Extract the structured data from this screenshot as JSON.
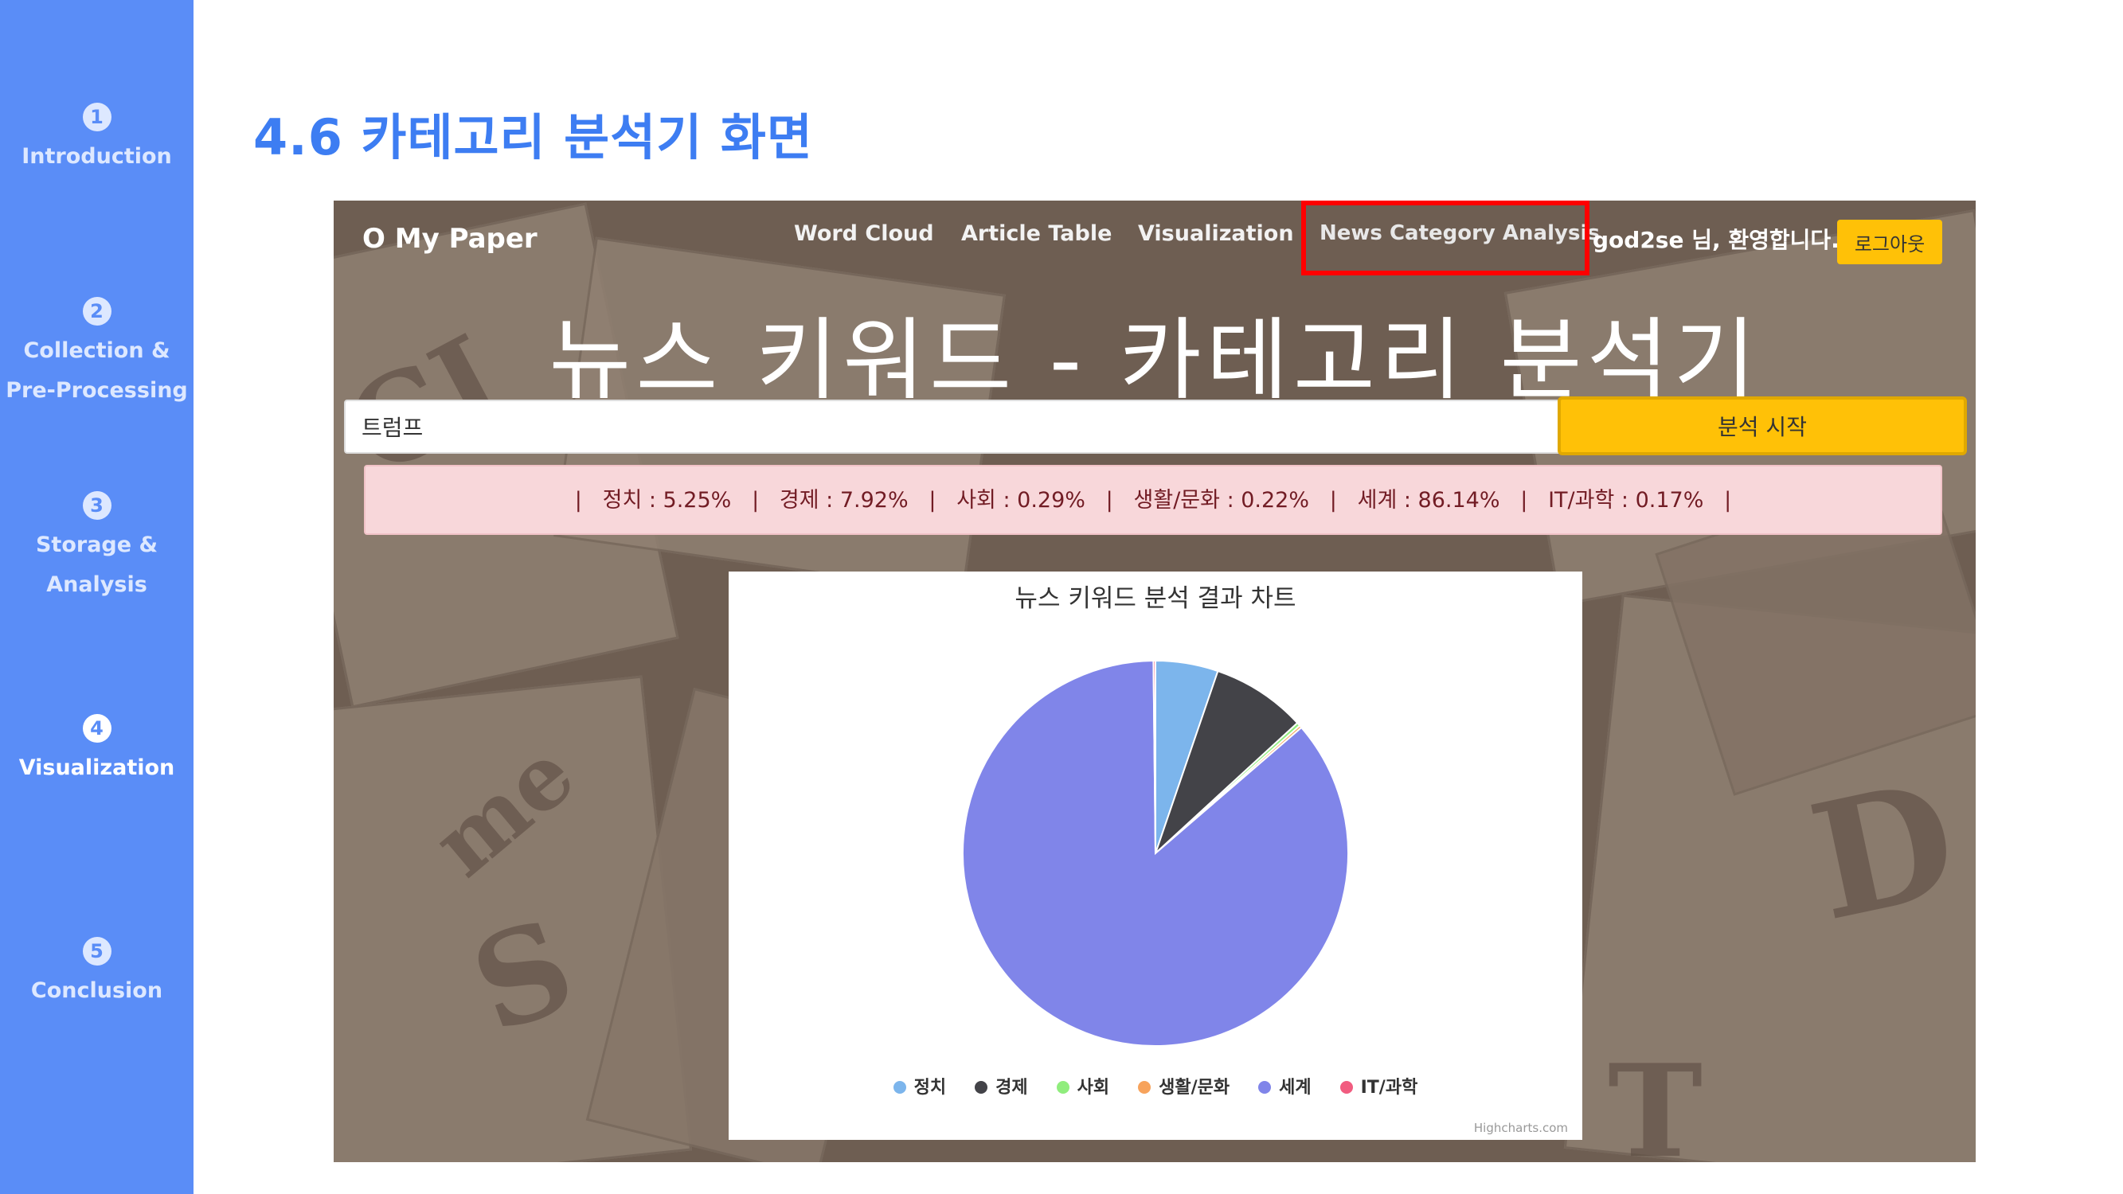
{
  "sidebar": {
    "items": [
      {
        "num": "1",
        "label_lines": [
          "Introduction"
        ],
        "active": false
      },
      {
        "num": "2",
        "label_lines": [
          "Collection &",
          "Pre-Processing"
        ],
        "active": false
      },
      {
        "num": "3",
        "label_lines": [
          "Storage &",
          "Analysis"
        ],
        "active": false
      },
      {
        "num": "4",
        "label_lines": [
          "Visualization"
        ],
        "active": true
      },
      {
        "num": "5",
        "label_lines": [
          "Conclusion"
        ],
        "active": false
      }
    ]
  },
  "slide": {
    "title": "4.6 카테고리 분석기 화면"
  },
  "app": {
    "brand": "O My Paper",
    "nav": [
      "Word Cloud",
      "Article Table",
      "Visualization",
      "News Category Analysis"
    ],
    "welcome": "god2se 님, 환영합니다.",
    "logout_label": "로그아웃",
    "heading": "뉴스 키워드 - 카테고리 분석기",
    "search_value": "트럼프",
    "analyze_label": "분석 시작",
    "result_text": "|   정치 : 5.25%   |   경제 : 7.92%   |   사회 : 0.29%   |   생활/문화 : 0.22%   |   세계 : 86.14%   |   IT/과학 : 0.17%   |"
  },
  "chart_data": {
    "type": "pie",
    "title": "뉴스 키워드 분석 결과 차트",
    "categories": [
      "정치",
      "경제",
      "사회",
      "생활/문화",
      "세계",
      "IT/과학"
    ],
    "values": [
      5.25,
      7.92,
      0.29,
      0.22,
      86.14,
      0.17
    ],
    "colors": [
      "#7CB5EC",
      "#434348",
      "#90ED7D",
      "#F7A35C",
      "#8085E9",
      "#F15C80"
    ],
    "legend_position": "bottom",
    "credits": "Highcharts.com"
  }
}
